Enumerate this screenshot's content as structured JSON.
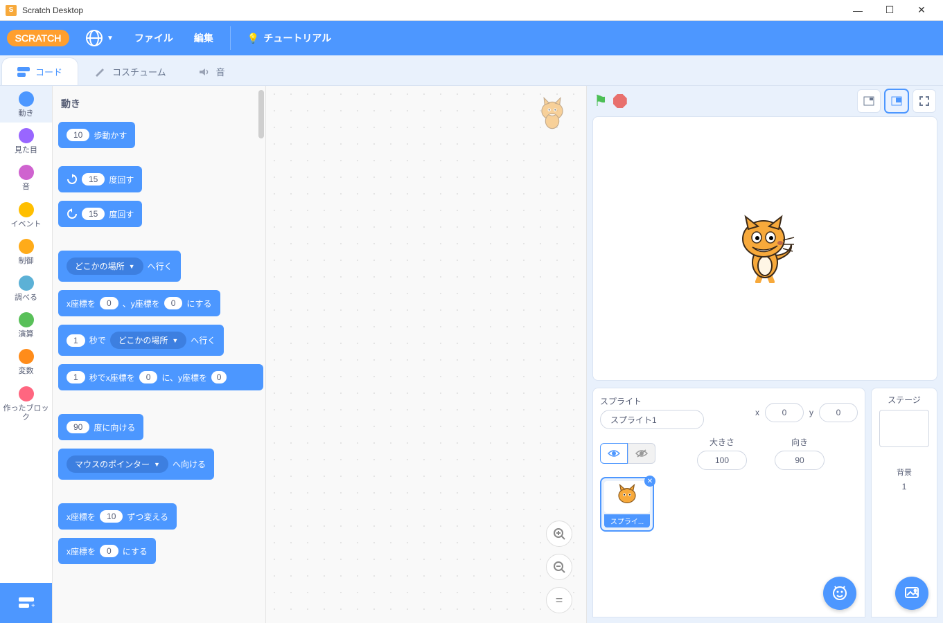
{
  "window": {
    "title": "Scratch Desktop"
  },
  "menubar": {
    "file": "ファイル",
    "edit": "編集",
    "tutorials": "チュートリアル"
  },
  "tabs": {
    "code": "コード",
    "costumes": "コスチューム",
    "sounds": "音"
  },
  "categories": [
    {
      "name": "動き",
      "color": "#4c97ff"
    },
    {
      "name": "見た目",
      "color": "#9966ff"
    },
    {
      "name": "音",
      "color": "#cf63cf"
    },
    {
      "name": "イベント",
      "color": "#ffbf00"
    },
    {
      "name": "制御",
      "color": "#ffab19"
    },
    {
      "name": "調べる",
      "color": "#5cb1d6"
    },
    {
      "name": "演算",
      "color": "#59c059"
    },
    {
      "name": "変数",
      "color": "#ff8c1a"
    },
    {
      "name": "作ったブロック",
      "color": "#ff6680"
    }
  ],
  "palette": {
    "section": "動き",
    "b_move_steps_v": "10",
    "b_move_steps_t": "歩動かす",
    "b_turn_cw_v": "15",
    "b_turn_cw_t": "度回す",
    "b_turn_ccw_v": "15",
    "b_turn_ccw_t": "度回す",
    "b_goto_dd": "どこかの場所",
    "b_goto_t": "へ行く",
    "b_gotoxy_p1": "x座標を",
    "b_gotoxy_v1": "0",
    "b_gotoxy_p2": "、y座標を",
    "b_gotoxy_v2": "0",
    "b_gotoxy_t": "にする",
    "b_glide_to_v": "1",
    "b_glide_to_p1": "秒で",
    "b_glide_to_dd": "どこかの場所",
    "b_glide_to_t": "へ行く",
    "b_glide_xy_v": "1",
    "b_glide_xy_p1": "秒でx座標を",
    "b_glide_xy_v2": "0",
    "b_glide_xy_p2": "に、y座標を",
    "b_glide_xy_v3": "0",
    "b_point_dir_v": "90",
    "b_point_dir_t": "度に向ける",
    "b_point_to_dd": "マウスのポインター",
    "b_point_to_t": "へ向ける",
    "b_changex_p1": "x座標を",
    "b_changex_v": "10",
    "b_changex_t": "ずつ変える",
    "b_setx_p1": "x座標を",
    "b_setx_v": "0",
    "b_setx_t": "にする"
  },
  "sprite_panel": {
    "label": "スプライト",
    "name": "スプライト1",
    "x_label": "x",
    "x": "0",
    "y_label": "y",
    "y": "0",
    "size_label": "大きさ",
    "size": "100",
    "dir_label": "向き",
    "dir": "90",
    "thumb_label": "スプライ..."
  },
  "stage_panel": {
    "label": "ステージ",
    "backdrops_label": "背景",
    "backdrops_count": "1"
  }
}
